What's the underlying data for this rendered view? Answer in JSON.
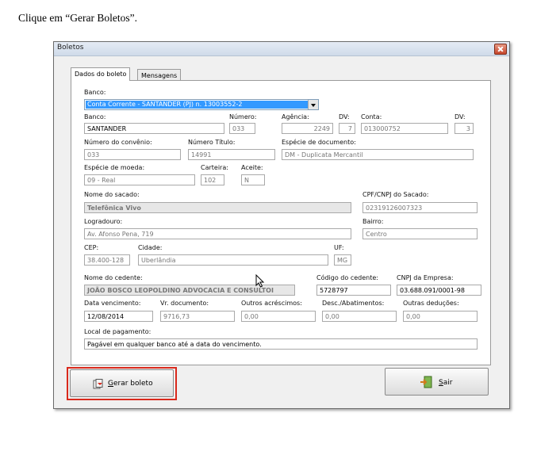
{
  "instruction": "Clique em “Gerar Boletos”.",
  "window": {
    "title": "Boletos"
  },
  "tabs": [
    "Dados do boleto",
    "Mensagens"
  ],
  "form": {
    "banco_select_label": "Banco:",
    "banco_select_value": "Conta Corrente - SANTANDER (PJ) n. 13003552-2",
    "labels": {
      "banco": "Banco:",
      "numero": "Número:",
      "agencia": "Agência:",
      "dv1": "DV:",
      "conta": "Conta:",
      "dv2": "DV:",
      "num_convenio": "Número do convênio:",
      "num_titulo": "Número Título:",
      "especie_doc": "Espécie de documento:",
      "especie_moeda": "Espécie de moeda:",
      "carteira": "Carteira:",
      "aceite": "Aceite:",
      "nome_sacado": "Nome do sacado:",
      "cpf_sacado": "CPF/CNPJ do Sacado:",
      "logradouro": "Logradouro:",
      "bairro": "Bairro:",
      "cep": "CEP:",
      "cidade": "Cidade:",
      "uf": "UF:",
      "nome_cedente": "Nome do cedente:",
      "codigo_cedente": "Código do cedente:",
      "cnpj_empresa": "CNPJ da Empresa:",
      "data_venc": "Data vencimento:",
      "vr_doc": "Vr. documento:",
      "outros_acresc": "Outros acréscimos:",
      "desc_abat": "Desc./Abatimentos:",
      "outras_ded": "Outras deduções:",
      "local_pag": "Local de pagamento:"
    },
    "values": {
      "banco": "SANTANDER",
      "numero": "033",
      "agencia": "2249",
      "dv1": "7",
      "conta": "013000752",
      "dv2": "3",
      "num_convenio": "033",
      "num_titulo": "14991",
      "especie_doc": "DM - Duplicata Mercantil",
      "especie_moeda": "09 - Real",
      "carteira": "102",
      "aceite": "N",
      "nome_sacado": "Telefônica Vivo",
      "cpf_sacado": "02319126007323",
      "logradouro": "Av. Afonso Pena, 719",
      "bairro": "Centro",
      "cep": "38.400-128",
      "cidade": "Uberlândia",
      "uf": "MG",
      "nome_cedente": "JOÃO BOSCO LEOPOLDINO ADVOCACIA E CONSULTOI",
      "codigo_cedente": "5728797",
      "cnpj_empresa": "03.688.091/0001-98",
      "data_venc": "12/08/2014",
      "vr_doc": "9716,73",
      "outros_acresc": "0,00",
      "desc_abat": "0,00",
      "outras_ded": "0,00",
      "local_pag": "Pagável em qualquer banco até a data do vencimento."
    }
  },
  "buttons": {
    "gerar": "Gerar boleto",
    "sair": "Sair"
  },
  "colors": {
    "highlight": "#d9291c",
    "selection": "#3399ff"
  }
}
